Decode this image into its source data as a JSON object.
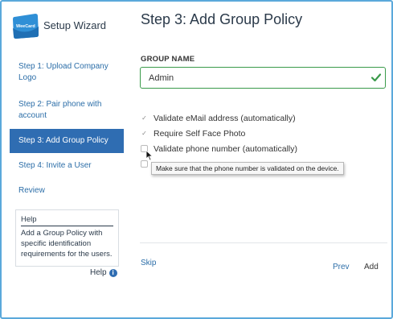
{
  "sidebar": {
    "app_title": "Setup Wizard",
    "logo_text": "WeeCard",
    "items": [
      {
        "label": "Step 1: Upload Company Logo",
        "active": false
      },
      {
        "label": "Step 2: Pair phone with account",
        "active": false
      },
      {
        "label": "Step 3: Add Group Policy",
        "active": true
      },
      {
        "label": "Step 4: Invite a User",
        "active": false
      },
      {
        "label": "Review",
        "active": false
      }
    ],
    "help_box": {
      "heading": "Help",
      "text": "Add a Group Policy with specific identification requirements for the users."
    },
    "help_link": "Help"
  },
  "main": {
    "title": "Step 3: Add Group Policy",
    "group_name_label": "GROUP NAME",
    "group_name_value": "Admin",
    "checkboxes": [
      {
        "label": "Validate eMail address (automatically)",
        "checked": true
      },
      {
        "label": "Require Self Face Photo",
        "checked": true
      },
      {
        "label": "Validate phone number (automatically)",
        "checked": false
      }
    ],
    "tooltip": "Make sure that the phone number is validated on the device."
  },
  "footer": {
    "skip": "Skip",
    "prev": "Prev",
    "add": "Add"
  },
  "colors": {
    "frame_border": "#5aa8db",
    "active_step": "#2f6db2",
    "link": "#2c6ea8",
    "input_valid": "#3a9a4a"
  },
  "icons": {
    "logo": "weecard-logo-icon",
    "input_status": "checkmark-icon",
    "help": "info-icon",
    "cursor": "mouse-pointer-icon"
  }
}
